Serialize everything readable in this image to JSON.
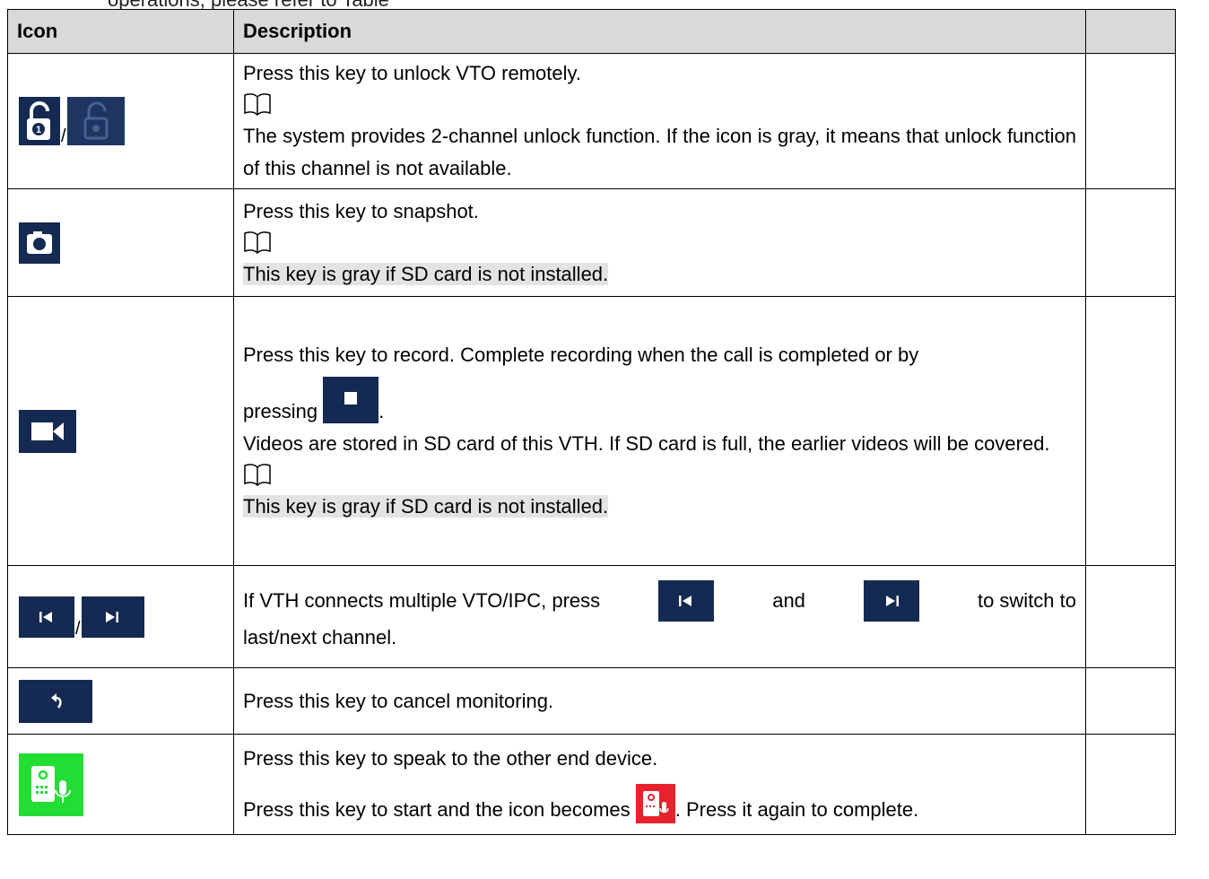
{
  "intro_text": "operations, please refer to Table",
  "table": {
    "headers": {
      "icon": "Icon",
      "description": "Description"
    },
    "rows": [
      {
        "icons": [
          "unlock-1-icon",
          "unlock-2-icon-gray"
        ],
        "lines": [
          "Press this key to unlock VTO remotely.",
          "The system provides 2-channel unlock function. If the icon is gray, it means that unlock function of this channel is not available."
        ]
      },
      {
        "icons": [
          "camera-icon"
        ],
        "lines": [
          "Press this key to snapshot.",
          "This key is gray if SD card is not installed."
        ]
      },
      {
        "icons": [
          "video-camera-icon",
          "stop-icon"
        ],
        "lines": [
          "Press this key to record. Complete recording when the call is completed or by",
          "pressing",
          ".",
          "Videos are stored in SD card of this VTH. If SD card is full, the earlier videos will be covered.",
          "This key is gray if SD card is not installed."
        ]
      },
      {
        "icons": [
          "previous-channel-icon",
          "next-channel-icon"
        ],
        "lines": [
          "If VTH connects multiple VTO/IPC, press",
          "and",
          "to switch to",
          "last/next channel."
        ]
      },
      {
        "icons": [
          "back-icon"
        ],
        "lines": [
          "Press this key to cancel monitoring."
        ]
      },
      {
        "icons": [
          "speak-icon",
          "speaking-icon"
        ],
        "lines": [
          "Press this key to speak to the other end device.",
          "Press this key to start and the icon becomes",
          ". Press it again to complete."
        ]
      }
    ],
    "icon_separator": "/"
  },
  "colors": {
    "icon_navy": "#152a52",
    "talk_green": "#22dd33",
    "talk_red": "#e8212e",
    "header_gray": "#d9d9d9",
    "highlight_gray": "#e3e3e3"
  }
}
